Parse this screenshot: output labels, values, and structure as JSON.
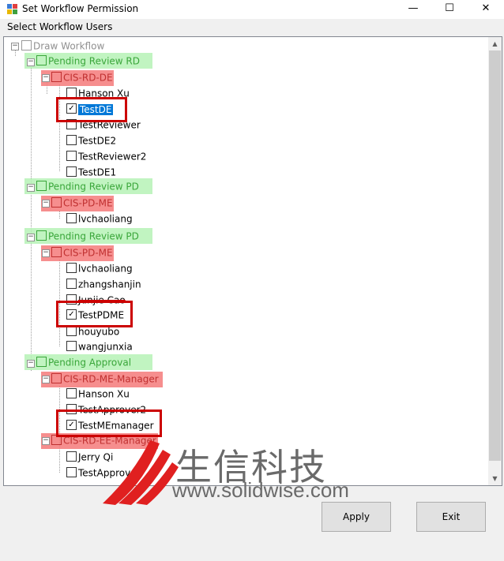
{
  "window": {
    "title": "Set Workflow Permission",
    "minimize_glyph": "—",
    "maximize_glyph": "☐",
    "close_glyph": "✕"
  },
  "section_label": "Select Workflow Users",
  "tree": {
    "root": "Draw Workflow",
    "nodes": [
      {
        "label": "Pending Review RD"
      },
      {
        "label": "CIS-RD-DE"
      },
      {
        "label": "Hanson Xu"
      },
      {
        "label": "TestDE",
        "checked": true
      },
      {
        "label": "TestReviewer"
      },
      {
        "label": "TestDE2"
      },
      {
        "label": "TestReviewer2"
      },
      {
        "label": "TestDE1"
      },
      {
        "label": "Pending Review PD"
      },
      {
        "label": "CIS-PD-ME"
      },
      {
        "label": "lvchaoliang"
      },
      {
        "label": "Pending Review PD"
      },
      {
        "label": "CIS-PD-ME"
      },
      {
        "label": "lvchaoliang"
      },
      {
        "label": "zhangshanjin"
      },
      {
        "label": "Junjie Cao"
      },
      {
        "label": "TestPDME",
        "checked": true
      },
      {
        "label": "houyubo"
      },
      {
        "label": "wangjunxia"
      },
      {
        "label": "Pending Approval"
      },
      {
        "label": "CIS-RD-ME-Manager"
      },
      {
        "label": "Hanson Xu"
      },
      {
        "label": "TestApprover2"
      },
      {
        "label": "TestMEmanager",
        "checked": true
      },
      {
        "label": "CIS-RD-EE-Manager"
      },
      {
        "label": "Jerry Qi"
      },
      {
        "label": "TestApprover"
      }
    ]
  },
  "buttons": {
    "apply": "Apply",
    "exit": "Exit"
  },
  "watermark": {
    "chinese": "生信科技",
    "url": "www.solidwise.com"
  },
  "colors": {
    "selection": "#0078d7",
    "highlight_red": "#f47a7a",
    "highlight_green": "#b6f2b6",
    "annotation_box": "#cc0000"
  }
}
